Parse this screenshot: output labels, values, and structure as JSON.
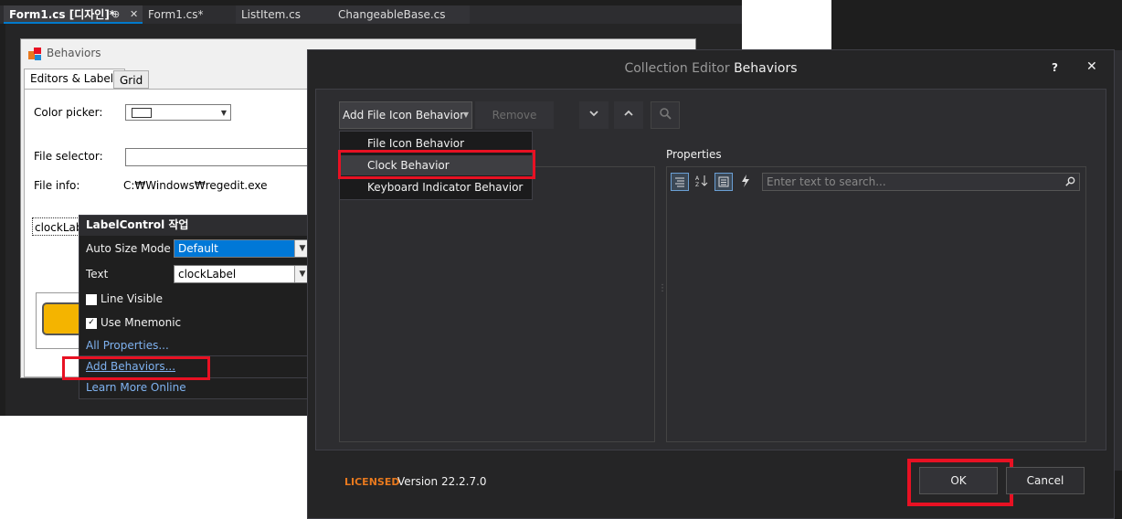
{
  "ide": {
    "tabs": [
      {
        "label": "Form1.cs [디자인]*",
        "pin": "⊕",
        "close": "✕"
      },
      {
        "label": "Form1.cs*"
      },
      {
        "label": "ListItem.cs"
      },
      {
        "label": "ChangeableBase.cs"
      }
    ]
  },
  "form": {
    "title": "Behaviors",
    "tabs": [
      "Editors & Labels",
      "Grid"
    ],
    "color_picker_label": "Color picker:",
    "file_selector_label": "File selector:",
    "file_info_label": "File info:",
    "file_info_value": "C:₩Windows₩regedit.exe",
    "clock_label_text": "clockLabel"
  },
  "smart_tag": {
    "title": "LabelControl 작업",
    "auto_size_label": "Auto Size Mode",
    "auto_size_value": "Default",
    "text_label": "Text",
    "text_value": "clockLabel",
    "line_visible_label": "Line Visible",
    "line_visible_checked": false,
    "use_mnemonic_label": "Use Mnemonic",
    "use_mnemonic_checked": true,
    "all_properties_link": "All Properties...",
    "add_behaviors_link": "Add Behaviors...",
    "learn_more_link": "Learn More Online"
  },
  "dialog": {
    "title_prefix": "Collection Editor",
    "title_name": "Behaviors",
    "help": "?",
    "close": "✕",
    "add_button": "Add File Icon Behavior",
    "remove_button": "Remove",
    "menu_items": [
      "File Icon Behavior",
      "Clock Behavior",
      "Keyboard Indicator Behavior"
    ],
    "properties_label": "Properties",
    "search_placeholder": "Enter text to search...",
    "licensed": "LICENSED",
    "version": "Version 22.2.7.0",
    "ok_button": "OK",
    "cancel_button": "Cancel"
  },
  "colors": {
    "accent_blue": "#0078d7",
    "highlight_red": "#e81123",
    "licensed_orange": "#e8791e"
  }
}
